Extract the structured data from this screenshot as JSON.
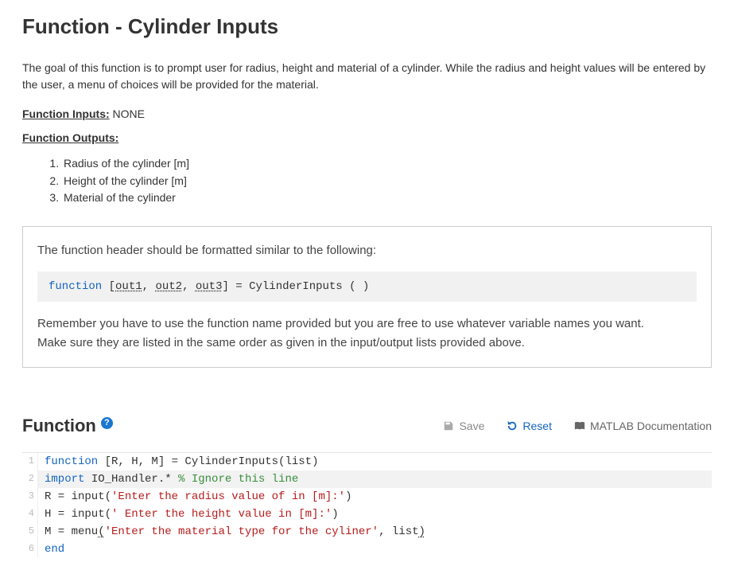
{
  "title": "Function - Cylinder Inputs",
  "intro": "The goal of this function is to prompt user for radius, height and material of a cylinder. While the radius and height  values will be entered by the user, a menu of choices will be provided for the material.",
  "func_inputs_label": "Function Inputs:",
  "func_inputs_value": " NONE",
  "func_outputs_label": "Function Outputs:",
  "outputs": [
    "Radius of the cylinder [m]",
    "Height of the cylinder [m]",
    "Material of the cylinder"
  ],
  "hint": {
    "line1": "The function header should be formatted similar to the following:",
    "kw": "function",
    "lb": " [",
    "o1": "out1",
    "c1": ", ",
    "o2": "out2",
    "c2": ", ",
    "o3": "out3",
    "tail": "] = CylinderInputs ( )",
    "rest1": "Remember you have to use the function name provided but you are free to use whatever variable names you want.",
    "rest2": "Make sure they are listed in the same order as given in the input/output lists provided above."
  },
  "section": {
    "title": "Function",
    "help": "?"
  },
  "toolbar": {
    "save": "Save",
    "reset": "Reset",
    "docs": "MATLAB Documentation"
  },
  "code": {
    "l1_kw": "function",
    "l1_rest": " [R, H, M] = CylinderInputs(list)",
    "l2_kw": "import",
    "l2_mod": " IO_Handler.* ",
    "l2_cmt": "% Ignore this line",
    "l3_a": "R = input(",
    "l3_s": "'Enter the radius value of in [m]:'",
    "l3_b": ")",
    "l4_a": "H = input(",
    "l4_s": "' Enter the height value in [m]:'",
    "l4_b": ")",
    "l5_a": "M = menu",
    "l5_p": "(",
    "l5_s": "'Enter the material type for the cyliner'",
    "l5_b": ", list",
    "l5_c": ")",
    "l6_kw": "end",
    "ln1": "1",
    "ln2": "2",
    "ln3": "3",
    "ln4": "4",
    "ln5": "5",
    "ln6": "6"
  },
  "chart_data": null
}
